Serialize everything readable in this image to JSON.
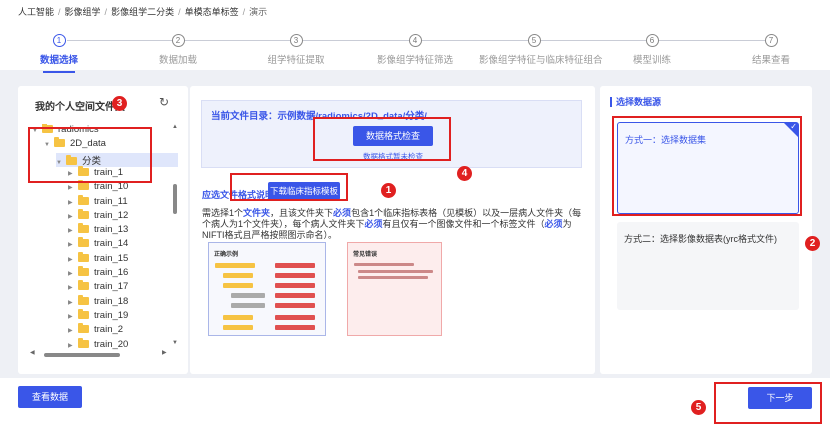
{
  "breadcrumb": [
    "人工智能",
    "影像组学",
    "影像组学二分类",
    "单模态单标签",
    "演示"
  ],
  "steps": [
    {
      "num": "1",
      "label": "数据选择",
      "active": true
    },
    {
      "num": "2",
      "label": "数据加载"
    },
    {
      "num": "3",
      "label": "组学特征提取"
    },
    {
      "num": "4",
      "label": "影像组学特征筛选"
    },
    {
      "num": "5",
      "label": "影像组学特征与临床特征组合"
    },
    {
      "num": "6",
      "label": "模型训练"
    },
    {
      "num": "7",
      "label": "结果查看"
    }
  ],
  "left": {
    "title": "我的个人空间文件夹",
    "refresh_icon": "refresh-icon",
    "tree": [
      {
        "label": "radiomics",
        "level": 0
      },
      {
        "label": "2D_data",
        "level": 1
      },
      {
        "label": "分类",
        "level": 2,
        "selected": true
      },
      {
        "label": "train_1",
        "level": 3
      },
      {
        "label": "train_10",
        "level": 3
      },
      {
        "label": "train_11",
        "level": 3
      },
      {
        "label": "train_12",
        "level": 3
      },
      {
        "label": "train_13",
        "level": 3
      },
      {
        "label": "train_14",
        "level": 3
      },
      {
        "label": "train_15",
        "level": 3
      },
      {
        "label": "train_16",
        "level": 3
      },
      {
        "label": "train_17",
        "level": 3
      },
      {
        "label": "train_18",
        "level": 3
      },
      {
        "label": "train_19",
        "level": 3
      },
      {
        "label": "train_2",
        "level": 3
      },
      {
        "label": "train_20",
        "level": 3
      }
    ]
  },
  "middle": {
    "dir_label": "当前文件目录：示例数据/radiomics/2D_data/分类/",
    "check_button": "数据格式检查",
    "check_msg": "数据格式暂未检查",
    "req_label": "应选文件格式说明",
    "download_button": "下载临床指标模板",
    "desc_1": "需选择1个",
    "desc_2": "文件夹",
    "desc_3": "，且该文件夹下",
    "desc_4": "必须",
    "desc_5": "包含1个临床指标表格（见模板）以及一层病人文件夹（每个病人为1个文件夹），每个病人文件夹下",
    "desc_6": "必须",
    "desc_7": "有且仅有一个图像文件和一个标签文件（",
    "desc_8": "必须",
    "desc_9": "为NIFTI格式且严格按照图示命名）。",
    "example_ok_title": "正确示例",
    "example_bad_title": "常见错误"
  },
  "right": {
    "title": "选择数据源",
    "option1": "方式一：选择数据集",
    "option2": "方式二：选择影像数据表(yrc格式文件)"
  },
  "bottom": {
    "view_button": "查看数据",
    "next_button": "下一步"
  },
  "annotations": [
    "1",
    "2",
    "3",
    "4",
    "5"
  ],
  "colors": {
    "accent": "#3a56e8",
    "annotation": "#e02020"
  }
}
